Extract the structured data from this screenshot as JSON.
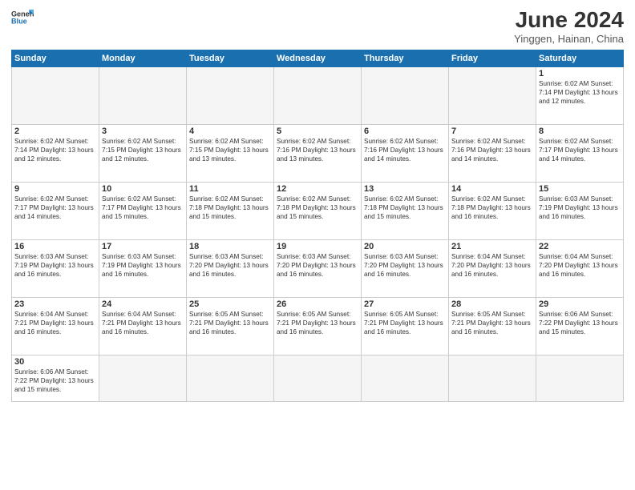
{
  "header": {
    "logo_general": "General",
    "logo_blue": "Blue",
    "title": "June 2024",
    "subtitle": "Yinggen, Hainan, China"
  },
  "days_of_week": [
    "Sunday",
    "Monday",
    "Tuesday",
    "Wednesday",
    "Thursday",
    "Friday",
    "Saturday"
  ],
  "weeks": [
    [
      {
        "day": "",
        "info": ""
      },
      {
        "day": "",
        "info": ""
      },
      {
        "day": "",
        "info": ""
      },
      {
        "day": "",
        "info": ""
      },
      {
        "day": "",
        "info": ""
      },
      {
        "day": "",
        "info": ""
      },
      {
        "day": "1",
        "info": "Sunrise: 6:02 AM\nSunset: 7:14 PM\nDaylight: 13 hours\nand 12 minutes."
      }
    ],
    [
      {
        "day": "2",
        "info": "Sunrise: 6:02 AM\nSunset: 7:14 PM\nDaylight: 13 hours\nand 12 minutes."
      },
      {
        "day": "3",
        "info": "Sunrise: 6:02 AM\nSunset: 7:15 PM\nDaylight: 13 hours\nand 12 minutes."
      },
      {
        "day": "4",
        "info": "Sunrise: 6:02 AM\nSunset: 7:15 PM\nDaylight: 13 hours\nand 13 minutes."
      },
      {
        "day": "5",
        "info": "Sunrise: 6:02 AM\nSunset: 7:16 PM\nDaylight: 13 hours\nand 13 minutes."
      },
      {
        "day": "6",
        "info": "Sunrise: 6:02 AM\nSunset: 7:16 PM\nDaylight: 13 hours\nand 14 minutes."
      },
      {
        "day": "7",
        "info": "Sunrise: 6:02 AM\nSunset: 7:16 PM\nDaylight: 13 hours\nand 14 minutes."
      },
      {
        "day": "8",
        "info": "Sunrise: 6:02 AM\nSunset: 7:17 PM\nDaylight: 13 hours\nand 14 minutes."
      }
    ],
    [
      {
        "day": "9",
        "info": "Sunrise: 6:02 AM\nSunset: 7:17 PM\nDaylight: 13 hours\nand 14 minutes."
      },
      {
        "day": "10",
        "info": "Sunrise: 6:02 AM\nSunset: 7:17 PM\nDaylight: 13 hours\nand 15 minutes."
      },
      {
        "day": "11",
        "info": "Sunrise: 6:02 AM\nSunset: 7:18 PM\nDaylight: 13 hours\nand 15 minutes."
      },
      {
        "day": "12",
        "info": "Sunrise: 6:02 AM\nSunset: 7:18 PM\nDaylight: 13 hours\nand 15 minutes."
      },
      {
        "day": "13",
        "info": "Sunrise: 6:02 AM\nSunset: 7:18 PM\nDaylight: 13 hours\nand 15 minutes."
      },
      {
        "day": "14",
        "info": "Sunrise: 6:02 AM\nSunset: 7:18 PM\nDaylight: 13 hours\nand 16 minutes."
      },
      {
        "day": "15",
        "info": "Sunrise: 6:03 AM\nSunset: 7:19 PM\nDaylight: 13 hours\nand 16 minutes."
      }
    ],
    [
      {
        "day": "16",
        "info": "Sunrise: 6:03 AM\nSunset: 7:19 PM\nDaylight: 13 hours\nand 16 minutes."
      },
      {
        "day": "17",
        "info": "Sunrise: 6:03 AM\nSunset: 7:19 PM\nDaylight: 13 hours\nand 16 minutes."
      },
      {
        "day": "18",
        "info": "Sunrise: 6:03 AM\nSunset: 7:20 PM\nDaylight: 13 hours\nand 16 minutes."
      },
      {
        "day": "19",
        "info": "Sunrise: 6:03 AM\nSunset: 7:20 PM\nDaylight: 13 hours\nand 16 minutes."
      },
      {
        "day": "20",
        "info": "Sunrise: 6:03 AM\nSunset: 7:20 PM\nDaylight: 13 hours\nand 16 minutes."
      },
      {
        "day": "21",
        "info": "Sunrise: 6:04 AM\nSunset: 7:20 PM\nDaylight: 13 hours\nand 16 minutes."
      },
      {
        "day": "22",
        "info": "Sunrise: 6:04 AM\nSunset: 7:20 PM\nDaylight: 13 hours\nand 16 minutes."
      }
    ],
    [
      {
        "day": "23",
        "info": "Sunrise: 6:04 AM\nSunset: 7:21 PM\nDaylight: 13 hours\nand 16 minutes."
      },
      {
        "day": "24",
        "info": "Sunrise: 6:04 AM\nSunset: 7:21 PM\nDaylight: 13 hours\nand 16 minutes."
      },
      {
        "day": "25",
        "info": "Sunrise: 6:05 AM\nSunset: 7:21 PM\nDaylight: 13 hours\nand 16 minutes."
      },
      {
        "day": "26",
        "info": "Sunrise: 6:05 AM\nSunset: 7:21 PM\nDaylight: 13 hours\nand 16 minutes."
      },
      {
        "day": "27",
        "info": "Sunrise: 6:05 AM\nSunset: 7:21 PM\nDaylight: 13 hours\nand 16 minutes."
      },
      {
        "day": "28",
        "info": "Sunrise: 6:05 AM\nSunset: 7:21 PM\nDaylight: 13 hours\nand 16 minutes."
      },
      {
        "day": "29",
        "info": "Sunrise: 6:06 AM\nSunset: 7:22 PM\nDaylight: 13 hours\nand 15 minutes."
      }
    ],
    [
      {
        "day": "30",
        "info": "Sunrise: 6:06 AM\nSunset: 7:22 PM\nDaylight: 13 hours\nand 15 minutes."
      },
      {
        "day": "",
        "info": ""
      },
      {
        "day": "",
        "info": ""
      },
      {
        "day": "",
        "info": ""
      },
      {
        "day": "",
        "info": ""
      },
      {
        "day": "",
        "info": ""
      },
      {
        "day": "",
        "info": ""
      }
    ]
  ]
}
